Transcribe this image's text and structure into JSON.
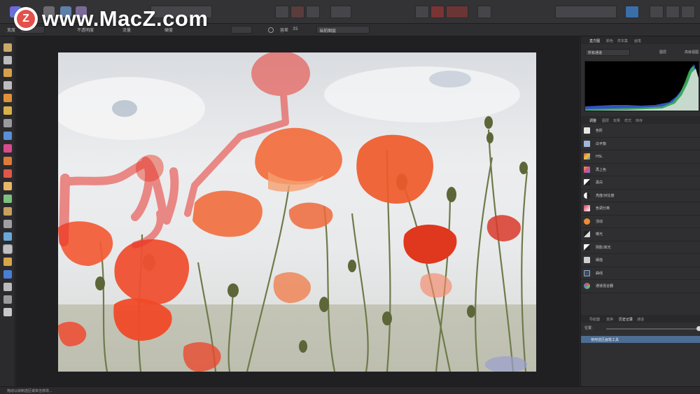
{
  "watermark": {
    "logo_letter": "Z",
    "text": "www.MacZ.com"
  },
  "context_toolbar": {
    "width_label": "宽度",
    "opacity_label": "不透明度",
    "flow_label": "流量",
    "hardness_label": "硬度",
    "tolerance_label": "容差",
    "tolerance_value": "35",
    "source_value": "当前图层"
  },
  "panels": {
    "tabs_top": [
      "直方图",
      "颜色",
      "样本集",
      "画笔"
    ],
    "histogram_channel": "所有通道",
    "histogram_options": [
      "图层",
      "高级视图"
    ],
    "tabs_middle": [
      "调整",
      "图层",
      "效果",
      "样式",
      "库存"
    ],
    "adjustments": [
      {
        "label": "色阶",
        "icon": "levels-icon",
        "color": "#e6e6e6"
      },
      {
        "label": "白平衡",
        "icon": "white-balance-icon",
        "color": "#9fb7d8"
      },
      {
        "label": "HSL",
        "icon": "hsl-icon",
        "color": "#d9534f"
      },
      {
        "label": "再上色",
        "icon": "recolor-icon",
        "color": "#f0a830"
      },
      {
        "label": "黑白",
        "icon": "black-white-icon",
        "color": "#bfbfbf"
      },
      {
        "label": "亮度/对比度",
        "icon": "brightness-contrast-icon",
        "color": "#d8d8d8"
      },
      {
        "label": "色调分离",
        "icon": "posterize-icon",
        "color": "#d9375b"
      },
      {
        "label": "活动",
        "icon": "vibrance-icon",
        "color": "#f08c30"
      },
      {
        "label": "曝光",
        "icon": "exposure-icon",
        "color": "#cfcfcf"
      },
      {
        "label": "阴影/高光",
        "icon": "shadows-highlights-icon",
        "color": "#e0e0e0"
      },
      {
        "label": "阈值",
        "icon": "threshold-icon",
        "color": "#cfcfcf"
      },
      {
        "label": "曲线",
        "icon": "curves-icon",
        "color": "#8fa8c8"
      },
      {
        "label": "通道混合器",
        "icon": "channel-mixer-icon",
        "color": "#6fbf6f"
      }
    ],
    "tabs_bottom": [
      "导航器",
      "变换",
      "历史记录",
      "通道"
    ],
    "history_opacity_label": "位置:",
    "history_item": "使用选区画笔工具"
  },
  "status_text": "拖动以绘制选区或单击修改..."
}
